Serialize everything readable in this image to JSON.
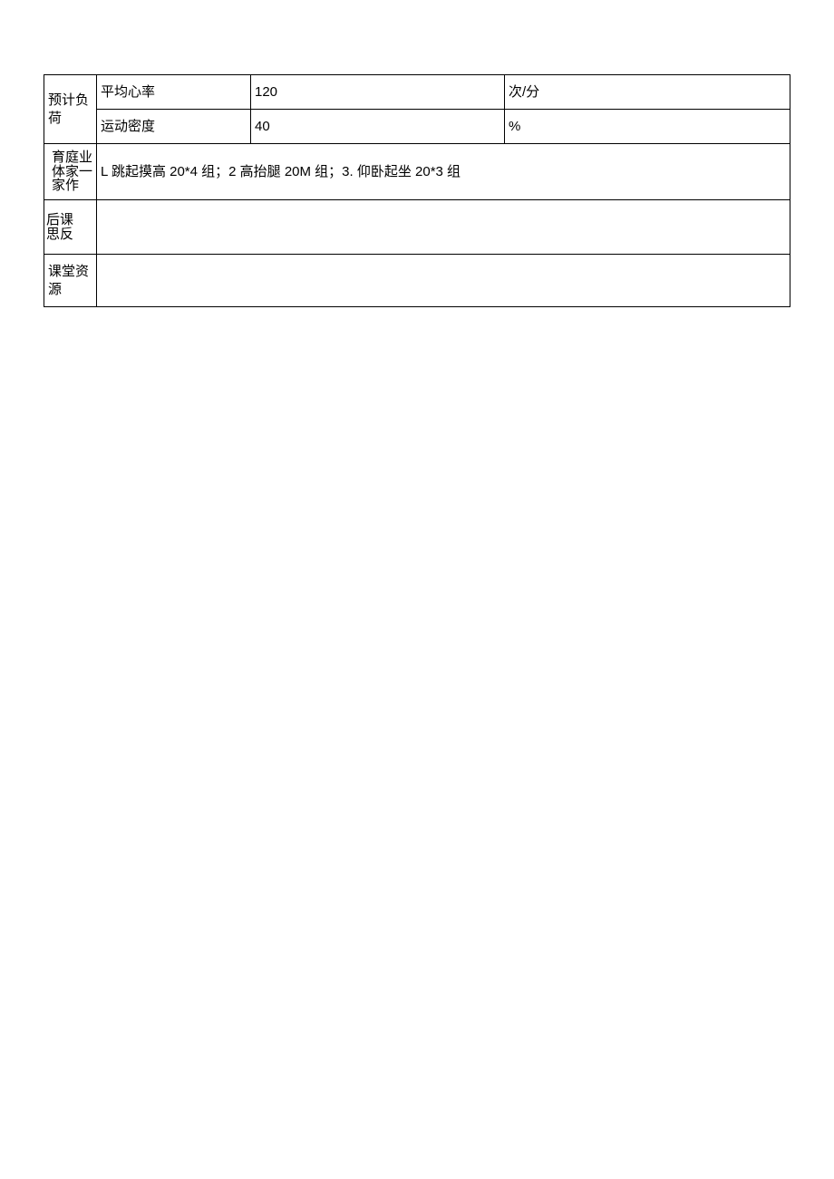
{
  "load": {
    "label": "预计负荷",
    "rows": [
      {
        "name": "平均心率",
        "value": "120",
        "unit": "次/分"
      },
      {
        "name": "运动密度",
        "value": "40",
        "unit": "%"
      }
    ]
  },
  "homework": {
    "label_cols": [
      "育体家",
      "庭家作",
      "业一"
    ],
    "label_col1": [
      "育",
      "体",
      "家"
    ],
    "label_col2": [
      "庭",
      "家",
      "作"
    ],
    "label_col3": [
      "业",
      "一"
    ],
    "text": "L 跳起摸高 20*4 组；2 高抬腿 20M 组；3. 仰卧起坐 20*3 组"
  },
  "reflection": {
    "label_col1": [
      "后",
      "思"
    ],
    "label_col2": [
      "课",
      "反"
    ],
    "text": ""
  },
  "resources": {
    "label": "课堂资源",
    "text": ""
  }
}
